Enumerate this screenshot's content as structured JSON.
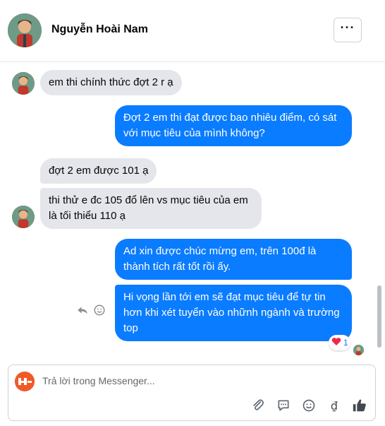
{
  "header": {
    "name": "Nguyễn Hoài Nam",
    "more_label": "···"
  },
  "messages": {
    "m1": "em thi chính thức đợt 2 r ạ",
    "m2": "Đợt 2 em thi đạt được bao nhiêu điểm, có sát với mục tiêu của mình không?",
    "m3": "đợt 2 em được 101 ạ",
    "m4": "thi thử e đc 105 đổ lên vs mục tiêu của em là tối thiểu 110 ạ",
    "m5": "Ad xin được chúc mừng em, trên 100đ là thành tích rất tốt rồi ấy.",
    "m6": "Hi vọng lần tới em sẽ đạt mục tiêu để tự tin hơn khi xét tuyển vào nhữnh ngành và trường top"
  },
  "reaction": {
    "emoji": "❤️",
    "count": "1"
  },
  "composer": {
    "placeholder": "Trả lời trong Messenger...",
    "currency_symbol": "₫"
  },
  "colors": {
    "outgoing": "#0a7cff",
    "incoming": "#e4e6eb",
    "logo": "#f05a28"
  }
}
